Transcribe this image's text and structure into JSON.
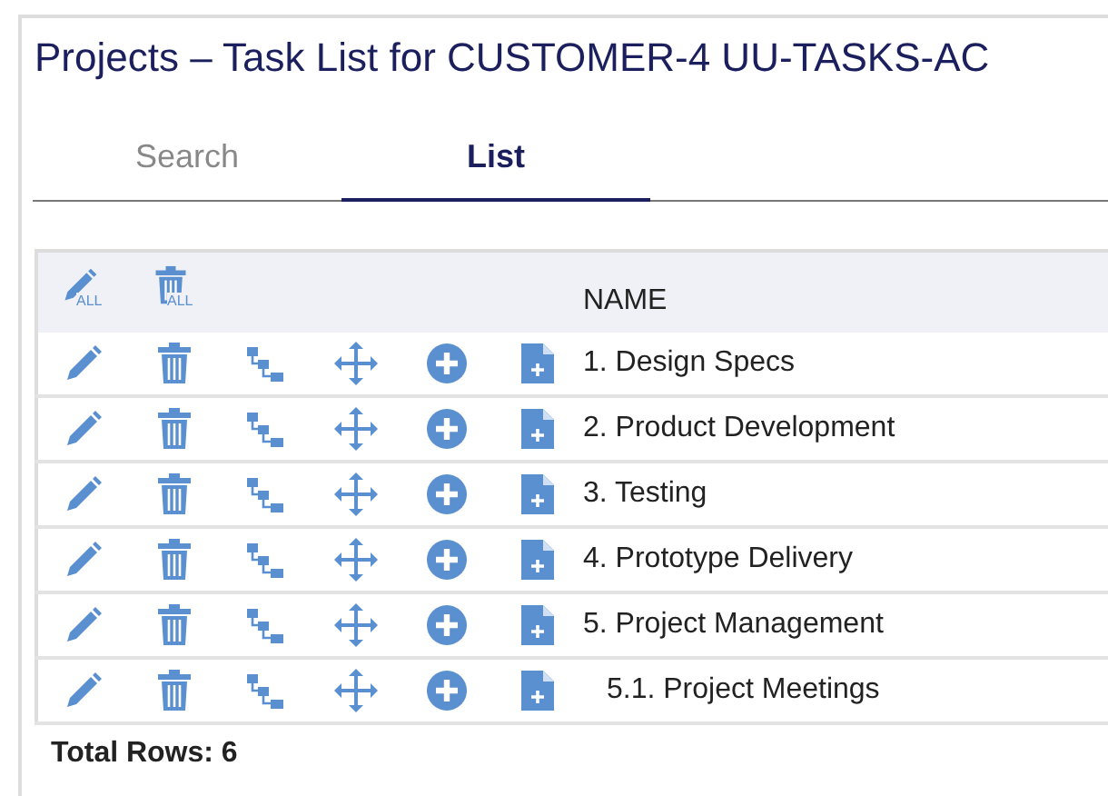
{
  "window": {
    "title": "Projects – Task List for CUSTOMER-4 UU-TASKS-AC"
  },
  "tabs": [
    {
      "label": "Search",
      "selected": false
    },
    {
      "label": "List",
      "selected": true
    }
  ],
  "table": {
    "header_icons": [
      {
        "kind": "edit",
        "label": "ALL"
      },
      {
        "kind": "delete",
        "label": "ALL"
      }
    ],
    "name_column": "NAME",
    "rows": [
      {
        "name": "1. Design Specs"
      },
      {
        "name": "2. Product Development"
      },
      {
        "name": "3. Testing"
      },
      {
        "name": "4. Prototype Delivery"
      },
      {
        "name": "5. Project Management",
        "children": [
          {
            "name": "5.1. Project Meetings"
          }
        ]
      }
    ]
  },
  "status_bar": {
    "total": "Total Rows: 6"
  }
}
